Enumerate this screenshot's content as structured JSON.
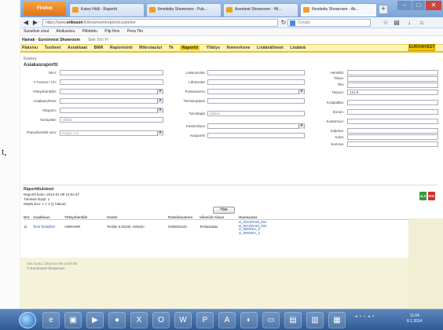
{
  "paper": {
    "comma": "t,"
  },
  "browser": {
    "app_button": "Firefox",
    "tabs": [
      {
        "label": "Katso Hälli - Raportit"
      },
      {
        "label": "Ilmoitettu Showroom - Pub..."
      },
      {
        "label": "Asenteet Showroom - Hil..."
      },
      {
        "label": "Ilmoitettu Showroom - Ak..."
      }
    ],
    "new_tab": "+",
    "window_controls": [
      "–",
      "□",
      "✕"
    ],
    "address": {
      "prefix": "https://www.",
      "host": "eriksson",
      "rest": ".fi/showroom/reports/customer"
    },
    "search_placeholder": "Google",
    "bookmarks": [
      "Suosituin sivut",
      "Aloitussivu",
      "Piilotettu",
      "Piip Ilmo",
      "Pess Tilo"
    ]
  },
  "site": {
    "top_title": "Hamak - Euroinvest Showroom",
    "top_user": "Sieli: Kli / Fi",
    "menu": [
      "Pääsivu",
      "Tuotteet",
      "Asiakkaat",
      "BMR",
      "Raportointi",
      "Mikrotaulut",
      "Tk",
      "Raportit",
      "Yllätys",
      "Ihmeerkone",
      "Lisäävälineet",
      "Lisäävä"
    ],
    "menu_active_index": 7,
    "logo": "EUROINVEST",
    "breadcrumb": "Etusivu",
    "form_title": "Asiakasraportti"
  },
  "form": {
    "col1": [
      {
        "label": "Nimi:",
        "value": "",
        "select": false
      },
      {
        "label": "Y-Tunnus / Ch:",
        "value": "",
        "select": false
      },
      {
        "label": "Yhteyshenkilöt:",
        "value": "",
        "select": true
      },
      {
        "label": "Asiakasryhmä:",
        "value": "",
        "select": true
      },
      {
        "label": "Alkupvm:",
        "value": "",
        "select": true
      },
      {
        "label": "Toimipiste:",
        "value": "Valitse",
        "select": false
      },
      {
        "label": "Yhteyshenkilö nimi:",
        "value": "Kriteja 1-9",
        "select": true
      }
    ],
    "col2": [
      {
        "label": "Laskuosoite:",
        "value": "",
        "select": false
      },
      {
        "label": "Lähiosoite:",
        "value": "",
        "select": false
      },
      {
        "label": "Postinumero:",
        "value": "",
        "select": true
      },
      {
        "label": "Toimistopäivä:",
        "value": "",
        "select": false
      },
      {
        "label": "Toimittajat:",
        "value": "Valitse",
        "select": false
      },
      {
        "label": "Kartat tilaus:",
        "value": "",
        "select": true
      },
      {
        "label": "Kaupunki:",
        "value": "",
        "select": false
      }
    ],
    "col3": [
      {
        "label": "Henkilöt:",
        "value": ""
      },
      {
        "label": "Tilaus:",
        "value": ""
      },
      {
        "label": "Tila:",
        "value": ""
      },
      {
        "label": "Tarjous:",
        "value": "131.6"
      },
      {
        "label": "Kotipaikka:",
        "value": ""
      },
      {
        "label": "Ennen:",
        "value": ""
      },
      {
        "label": "Kustannus:",
        "value": ""
      },
      {
        "label": "Kuljetus:",
        "value": ""
      },
      {
        "label": "Kulut:",
        "value": ""
      },
      {
        "label": "Summa:",
        "value": ""
      }
    ],
    "search_button": "Hae"
  },
  "results": {
    "title": "Raporttitulokset",
    "line1": "Raportti luotu: 2014-01-08 14:04:47",
    "line2": "Tuloksia löytyi: 1",
    "line3_prefix": "Näytä sivu:",
    "line3_links": "1 2 3",
    "line3_suffix": "(1 hakua)",
    "export_excel": "XLS",
    "export_pdf": "PDF"
  },
  "table": {
    "headers": [
      "Nro",
      "Asiakkuus",
      "Yhteyshenkilö",
      "Osoite",
      "Puhelinnumero",
      "Viimeisin tilaus",
      "Huomautus"
    ],
    "rows": [
      {
        "nro": "11",
        "asiakkuus": "Testi Testiyhtiö",
        "yhteys": "AMRAMIR",
        "osoite": "Testitie 5 00100, Helsinki",
        "puhelin": "0405000420",
        "tilaus": "Testiasiakas",
        "huom": "ei_DIAGRAM_001\nei_DIAGRAM_002\nei_MIKREA_3\nei_MIKREA_4"
      }
    ]
  },
  "footer": {
    "line1": "Sivu luotu: 2014-01-08 14:04:58",
    "line2": "© Euroinvest Showroom"
  },
  "taskbar": {
    "icons": [
      "ie-icon",
      "folder-icon",
      "media-icon",
      "firefox-icon",
      "excel-icon",
      "outlook-icon",
      "word-icon",
      "powerpoint-icon",
      "acrobat-icon",
      "paint-icon"
    ],
    "tray": "◂ ▪ ▪ ◂ ▪",
    "time": "11:04",
    "date": "8.1.2014"
  }
}
